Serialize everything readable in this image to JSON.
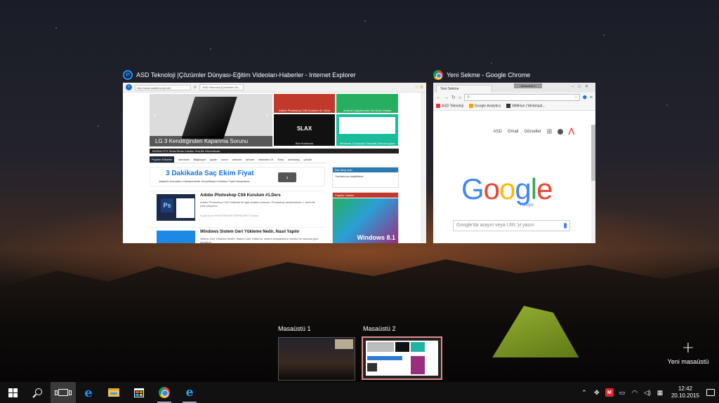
{
  "windows": [
    {
      "title": "ASD Teknoloji |Çözümler Dünyası-Eğitim Videoları-Haberler - Internet Explorer",
      "icon": "ie-icon",
      "content": {
        "url": "http://www.asdteknoloji.net/",
        "tab": "ASD Teknoloji |Çözümler Dü...",
        "hero_caption": "LG 3 Kendiliğinden Kapanma Sorunu",
        "tiles": [
          {
            "label": "Adobe Photoshop CS6 Kurulum #1. Ders",
            "color": "#c0392b"
          },
          {
            "label": "Android Uygulamalar Kurulumu Hatası",
            "color": "#27ae60"
          },
          {
            "label": "Box Kurulumu",
            "color": "#111111",
            "text": "SLAX"
          },
          {
            "label": "Windows 10 Açılışta Otomatik Oturum Açma",
            "color": "#1abc9c"
          }
        ],
        "news_strip": "NVIDIA GTX Serisi Ekran Kartları Yeni Bir Güncelleme",
        "tags": [
          "Popüler Etiketler",
          "windows",
          "Bilgisayar",
          "apple",
          "sorun",
          "android",
          "iphone",
          "windows 10",
          "Sony",
          "samsung",
          "çözüm"
        ],
        "ad_title": "3 Dakikada Saç Ekim Fiyat",
        "ad_desc": "Ataşehir Acıbadem Hastanesinde Gerçekleşen Ücretsiz Fiyat Hesaplama",
        "ad_button": "›",
        "posts": [
          {
            "title": "Adobe Photoshop CS6 Kurulum #1.Ders",
            "desc": "Adobe Photoshop CS6 Yükleme ile ilgili anlatım videosu. Photoshop derslerimizin 1. dersi ile yola çıkıyoruz.",
            "meta": "6 gün önce   PHOTOSHOP DERSLERİ   0 Yorum"
          },
          {
            "title": "Windows Sistem Geri Yükleme Nedir, Nasıl Yapılır",
            "desc": "Sistem Geri Yükleme Nedir? Sistem Geri Yükleme, sistem dosyalarınızı önceki bir zamana geri döndürür.",
            "meta": ""
          }
        ],
        "side_boxes": [
          {
            "header": "Bizi takip edin",
            "text": "Yazılarımızı bayiliklerle"
          },
          {
            "header": "Popüler Yazılar",
            "text": "Windows 8.1"
          }
        ]
      }
    },
    {
      "title": "Yeni Sekme - Google Chrome",
      "icon": "chrome-icon",
      "content": {
        "tab": "Yeni Sekme",
        "tooltip": "Masaüstü 2",
        "bookmarks": [
          "ASD Teknoloji",
          "Google Analytics",
          "WMHun | Webmast..."
        ],
        "links": [
          "ASD",
          "Gmail",
          "Görseller"
        ],
        "logo": [
          "G",
          "o",
          "o",
          "g",
          "l",
          "e"
        ],
        "logo_sub": "Türkiye",
        "search_placeholder": "Google'da arayın veya URL'yi yazın"
      }
    }
  ],
  "desktops": [
    {
      "label": "Masaüstü 1"
    },
    {
      "label": "Masaüstü 2",
      "selected": true
    }
  ],
  "new_desktop": {
    "icon": "+",
    "label": "Yeni masaüstü"
  },
  "taskbar": {
    "apps": [
      "start",
      "search",
      "task-view",
      "edge",
      "file-explorer",
      "store",
      "chrome",
      "internet-explorer"
    ],
    "time": "12:42",
    "date": "20.10.2015",
    "tray_mega": "M"
  }
}
